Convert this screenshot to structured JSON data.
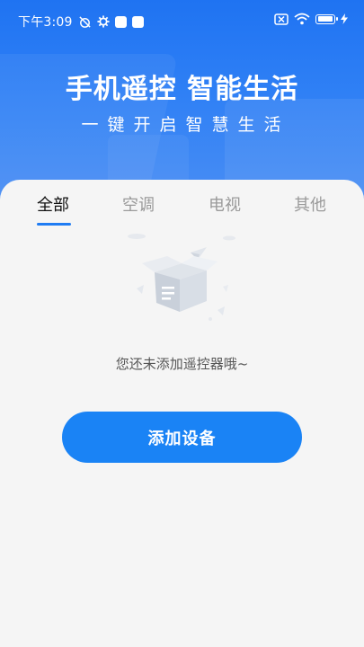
{
  "status_bar": {
    "time": "下午3:09"
  },
  "hero": {
    "title": "手机遥控 智能生活",
    "subtitle": "一键开启智慧生活"
  },
  "tabs": [
    {
      "label": "全部",
      "active": true
    },
    {
      "label": "空调",
      "active": false
    },
    {
      "label": "电视",
      "active": false
    },
    {
      "label": "其他",
      "active": false
    }
  ],
  "empty_state": {
    "message": "您还未添加遥控器哦~",
    "button_label": "添加设备"
  },
  "colors": {
    "accent": "#1a83f5",
    "hero_top": "#1f73f2",
    "background": "#f5f5f5"
  }
}
